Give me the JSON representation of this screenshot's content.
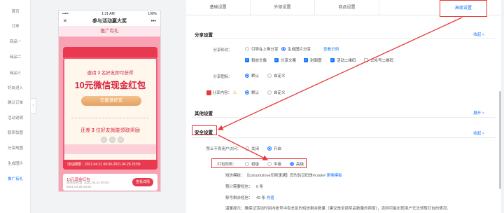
{
  "sidebar": {
    "items": [
      {
        "label": "首页",
        "active": false
      },
      {
        "label": "订单",
        "active": false
      },
      {
        "label": "商品一",
        "active": false
      },
      {
        "label": "商品二",
        "active": false
      },
      {
        "label": "商品三",
        "active": false
      },
      {
        "label": "好友进入",
        "active": false
      },
      {
        "label": "确认订单",
        "active": false
      },
      {
        "label": "活动说明",
        "active": false
      },
      {
        "label": "联系弦图",
        "active": false
      },
      {
        "label": "分享故图",
        "active": false
      },
      {
        "label": "生成图片",
        "active": false
      },
      {
        "label": "推广有礼",
        "active": true
      }
    ]
  },
  "phone": {
    "status_left": "•••••",
    "status_time": "1:21 AM",
    "status_right": "100%",
    "nav_title": "参与活动赢大奖",
    "close_glyph": "✕",
    "more_glyph": "•••",
    "promo_label": "推广有礼",
    "invite_prefix": "邀请",
    "invite_count": "3",
    "invite_suffix": "名好友即可获得",
    "headline": "10元微信现金红包",
    "invite_button": "去邀请好友",
    "remaining_prefix": "还差",
    "remaining_count": "3",
    "remaining_suffix": "位好友就能领取奖励",
    "countdown": "活动期限：2021.04.21 00:00-2021.04.28 23:59",
    "reward_title": "10元现金红包",
    "reward_line1": "本奖品包含: 2021.04.21 00:00-",
    "reward_line2": "2021.04.28 23:59",
    "reward_button": "查看详情"
  },
  "tabs": [
    {
      "label": "基础设置",
      "active": false
    },
    {
      "label": "外部设置",
      "active": false
    },
    {
      "label": "商品设置",
      "active": false
    },
    {
      "label": "高级设置",
      "active": true
    }
  ],
  "share_settings": {
    "title": "分享设置",
    "collapse": "收起",
    "mode_label": "分享形式：",
    "mode_options": [
      {
        "label": "引导在上角分享",
        "selected": false
      },
      {
        "label": "生成图片分享",
        "selected": true
      }
    ],
    "view_example": "查看示例",
    "checks": [
      {
        "label": "和放头像",
        "checked": true
      },
      {
        "label": "分享文案",
        "checked": true
      },
      {
        "label": "封面图",
        "checked": true
      },
      {
        "label": "活动二维码",
        "checked": true
      },
      {
        "label": "公众号二维码",
        "checked": false
      }
    ],
    "image_label": "分享图标：",
    "image_options": [
      {
        "label": "默认",
        "selected": true
      },
      {
        "label": "自定义",
        "selected": false
      }
    ],
    "content_label": "分享内容：",
    "content_options": [
      {
        "label": "默认",
        "selected": true
      },
      {
        "label": "自定义",
        "selected": false
      }
    ]
  },
  "other_settings": {
    "title": "其他设置",
    "expand": "展开"
  },
  "security_settings": {
    "title": "安全设置",
    "collapse": "收起",
    "block_label": "禁止不良用户访问：",
    "block_options": [
      {
        "label": "关闭",
        "selected": false
      },
      {
        "label": "开启",
        "selected": true
      }
    ],
    "level_label": "红包防刷：",
    "level_options": [
      {
        "label": "初级",
        "selected": false
      },
      {
        "label": "中级",
        "selected": false
      },
      {
        "label": "高级",
        "selected": true
      }
    ],
    "sms_label": "短信模板：",
    "sms_text": "【colourfullove印刷速通】您的验证码是#code#",
    "sms_link": "更换模板",
    "quota_label": "预计需要短信：",
    "quota_value": "0 条",
    "remain_label": "账号剩余短信：",
    "remain_value": "49 条",
    "remain_link": "充值",
    "tip_label": "温馨提示：",
    "tip_text": "确保证活动时间内帐号中有充足的短信剩余数量（建议是全部奖品数量的两倍），否则可能出现用户无法领取红包的情况。"
  }
}
